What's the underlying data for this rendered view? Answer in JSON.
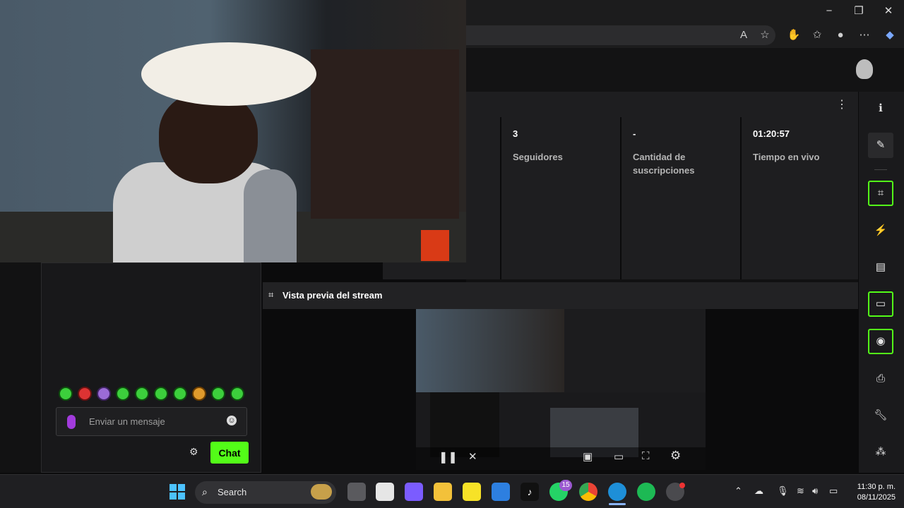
{
  "browser": {
    "window_controls": {
      "minimize": "−",
      "maximize": "❐",
      "close": "✕"
    },
    "toolbar_icons": [
      "read-aloud-icon",
      "favorite-icon",
      "extensions-icon",
      "favorites-bar-icon",
      "profile-icon",
      "more-icon",
      "copilot-icon"
    ]
  },
  "dashboard": {
    "stats": [
      {
        "value": "3",
        "label": "Seguidores"
      },
      {
        "value": "-",
        "label": "Cantidad de suscripciones"
      },
      {
        "value": "01:20:57",
        "label": "Tiempo en vivo"
      }
    ],
    "menu_glyph": "⋮"
  },
  "preview": {
    "title": "Vista previa del stream"
  },
  "chat": {
    "input_placeholder": "Enviar un mensaje",
    "send_label": "Chat",
    "accent": "#53fc18"
  },
  "rail": {
    "icons": [
      "info-icon",
      "pen-icon",
      "camera-focus-icon",
      "bolt-icon",
      "note-icon",
      "chat-bubble-icon",
      "broadcast-icon",
      "printer-icon",
      "wrench-icon",
      "apps-icon"
    ]
  },
  "taskbar": {
    "search_label": "Search",
    "whatsapp_badge": "15",
    "clock_time": "11:30 p. m.",
    "clock_date": "08/11/2025"
  }
}
